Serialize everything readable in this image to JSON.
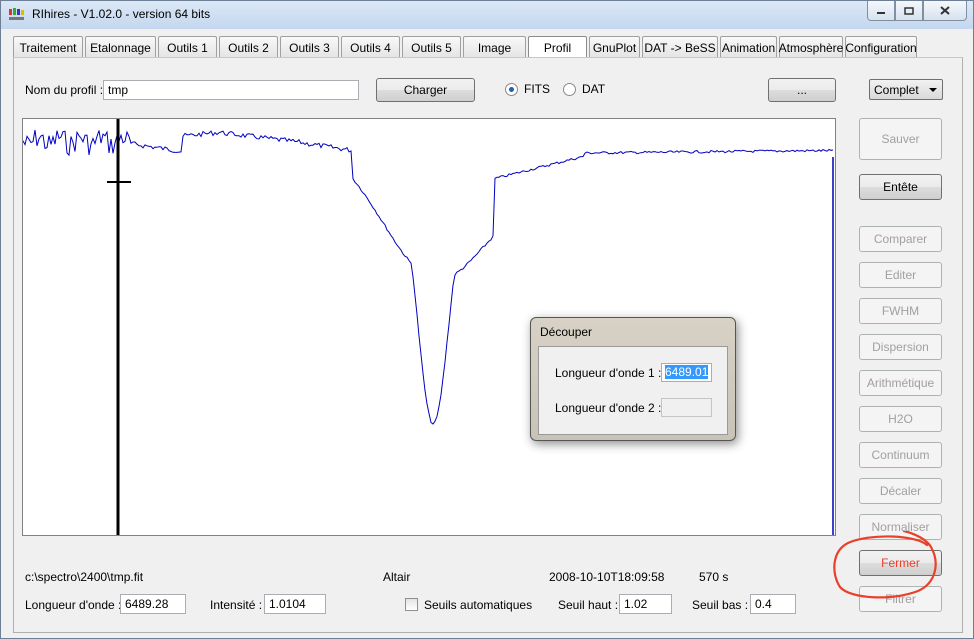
{
  "window": {
    "title": "RIhires - V1.02.0 - version 64 bits"
  },
  "tabs": [
    {
      "label": "Traitement",
      "w": 70
    },
    {
      "label": "Etalonnage",
      "w": 71
    },
    {
      "label": "Outils 1",
      "w": 59
    },
    {
      "label": "Outils 2",
      "w": 59
    },
    {
      "label": "Outils 3",
      "w": 59
    },
    {
      "label": "Outils 4",
      "w": 59
    },
    {
      "label": "Outils 5",
      "w": 59
    },
    {
      "label": "Image",
      "w": 63
    },
    {
      "label": "Profil",
      "w": 59
    },
    {
      "label": "GnuPlot",
      "w": 51
    },
    {
      "label": "DAT -> BeSS",
      "w": 76
    },
    {
      "label": "Animation",
      "w": 57
    },
    {
      "label": "Atmosphère",
      "w": 64
    },
    {
      "label": "Configuration",
      "w": 72
    }
  ],
  "active_tab": "Profil",
  "profile": {
    "name_label": "Nom du profil :",
    "name_value": "tmp",
    "load_button": "Charger",
    "format_fits": "FITS",
    "format_dat": "DAT",
    "browse_button": "...",
    "mode_select": "Complet"
  },
  "side_buttons": [
    {
      "label": "Sauver",
      "enabled": false
    },
    {
      "label": "Entête",
      "enabled": true
    },
    {
      "label": "Comparer",
      "enabled": false
    },
    {
      "label": "Editer",
      "enabled": false
    },
    {
      "label": "FWHM",
      "enabled": false
    },
    {
      "label": "Dispersion",
      "enabled": false
    },
    {
      "label": "Arithmétique",
      "enabled": false
    },
    {
      "label": "H2O",
      "enabled": false
    },
    {
      "label": "Continuum",
      "enabled": false
    },
    {
      "label": "Décaler",
      "enabled": false
    },
    {
      "label": "Normaliser",
      "enabled": false
    },
    {
      "label": "Fermer",
      "enabled": true
    },
    {
      "label": "Filtrer",
      "enabled": false
    }
  ],
  "status": {
    "file_path": "c:\\spectro\\2400\\tmp.fit",
    "object": "Altair",
    "date": "2008-10-10T18:09:58",
    "exposure": "570 s",
    "wavelength_label": "Longueur d'onde :",
    "wavelength_value": "6489.28",
    "intensity_label": "Intensité :",
    "intensity_value": "1.0104",
    "auto_threshold_label": "Seuils automatiques",
    "high_threshold_label": "Seuil haut :",
    "high_threshold_value": "1.02",
    "low_threshold_label": "Seuil bas :",
    "low_threshold_value": "0.4"
  },
  "dialog": {
    "title": "Découper",
    "wl1_label": "Longueur d'onde 1 :",
    "wl1_value": "6489.01",
    "wl2_label": "Longueur d'onde 2 :",
    "wl2_value": ""
  },
  "colors": {
    "spectrum": "#0000c0",
    "annotation": "#e8402a",
    "selection": "#3399ff"
  },
  "icons": {
    "minimize": "minimize-icon",
    "maximize": "maximize-icon",
    "close": "close-icon"
  }
}
